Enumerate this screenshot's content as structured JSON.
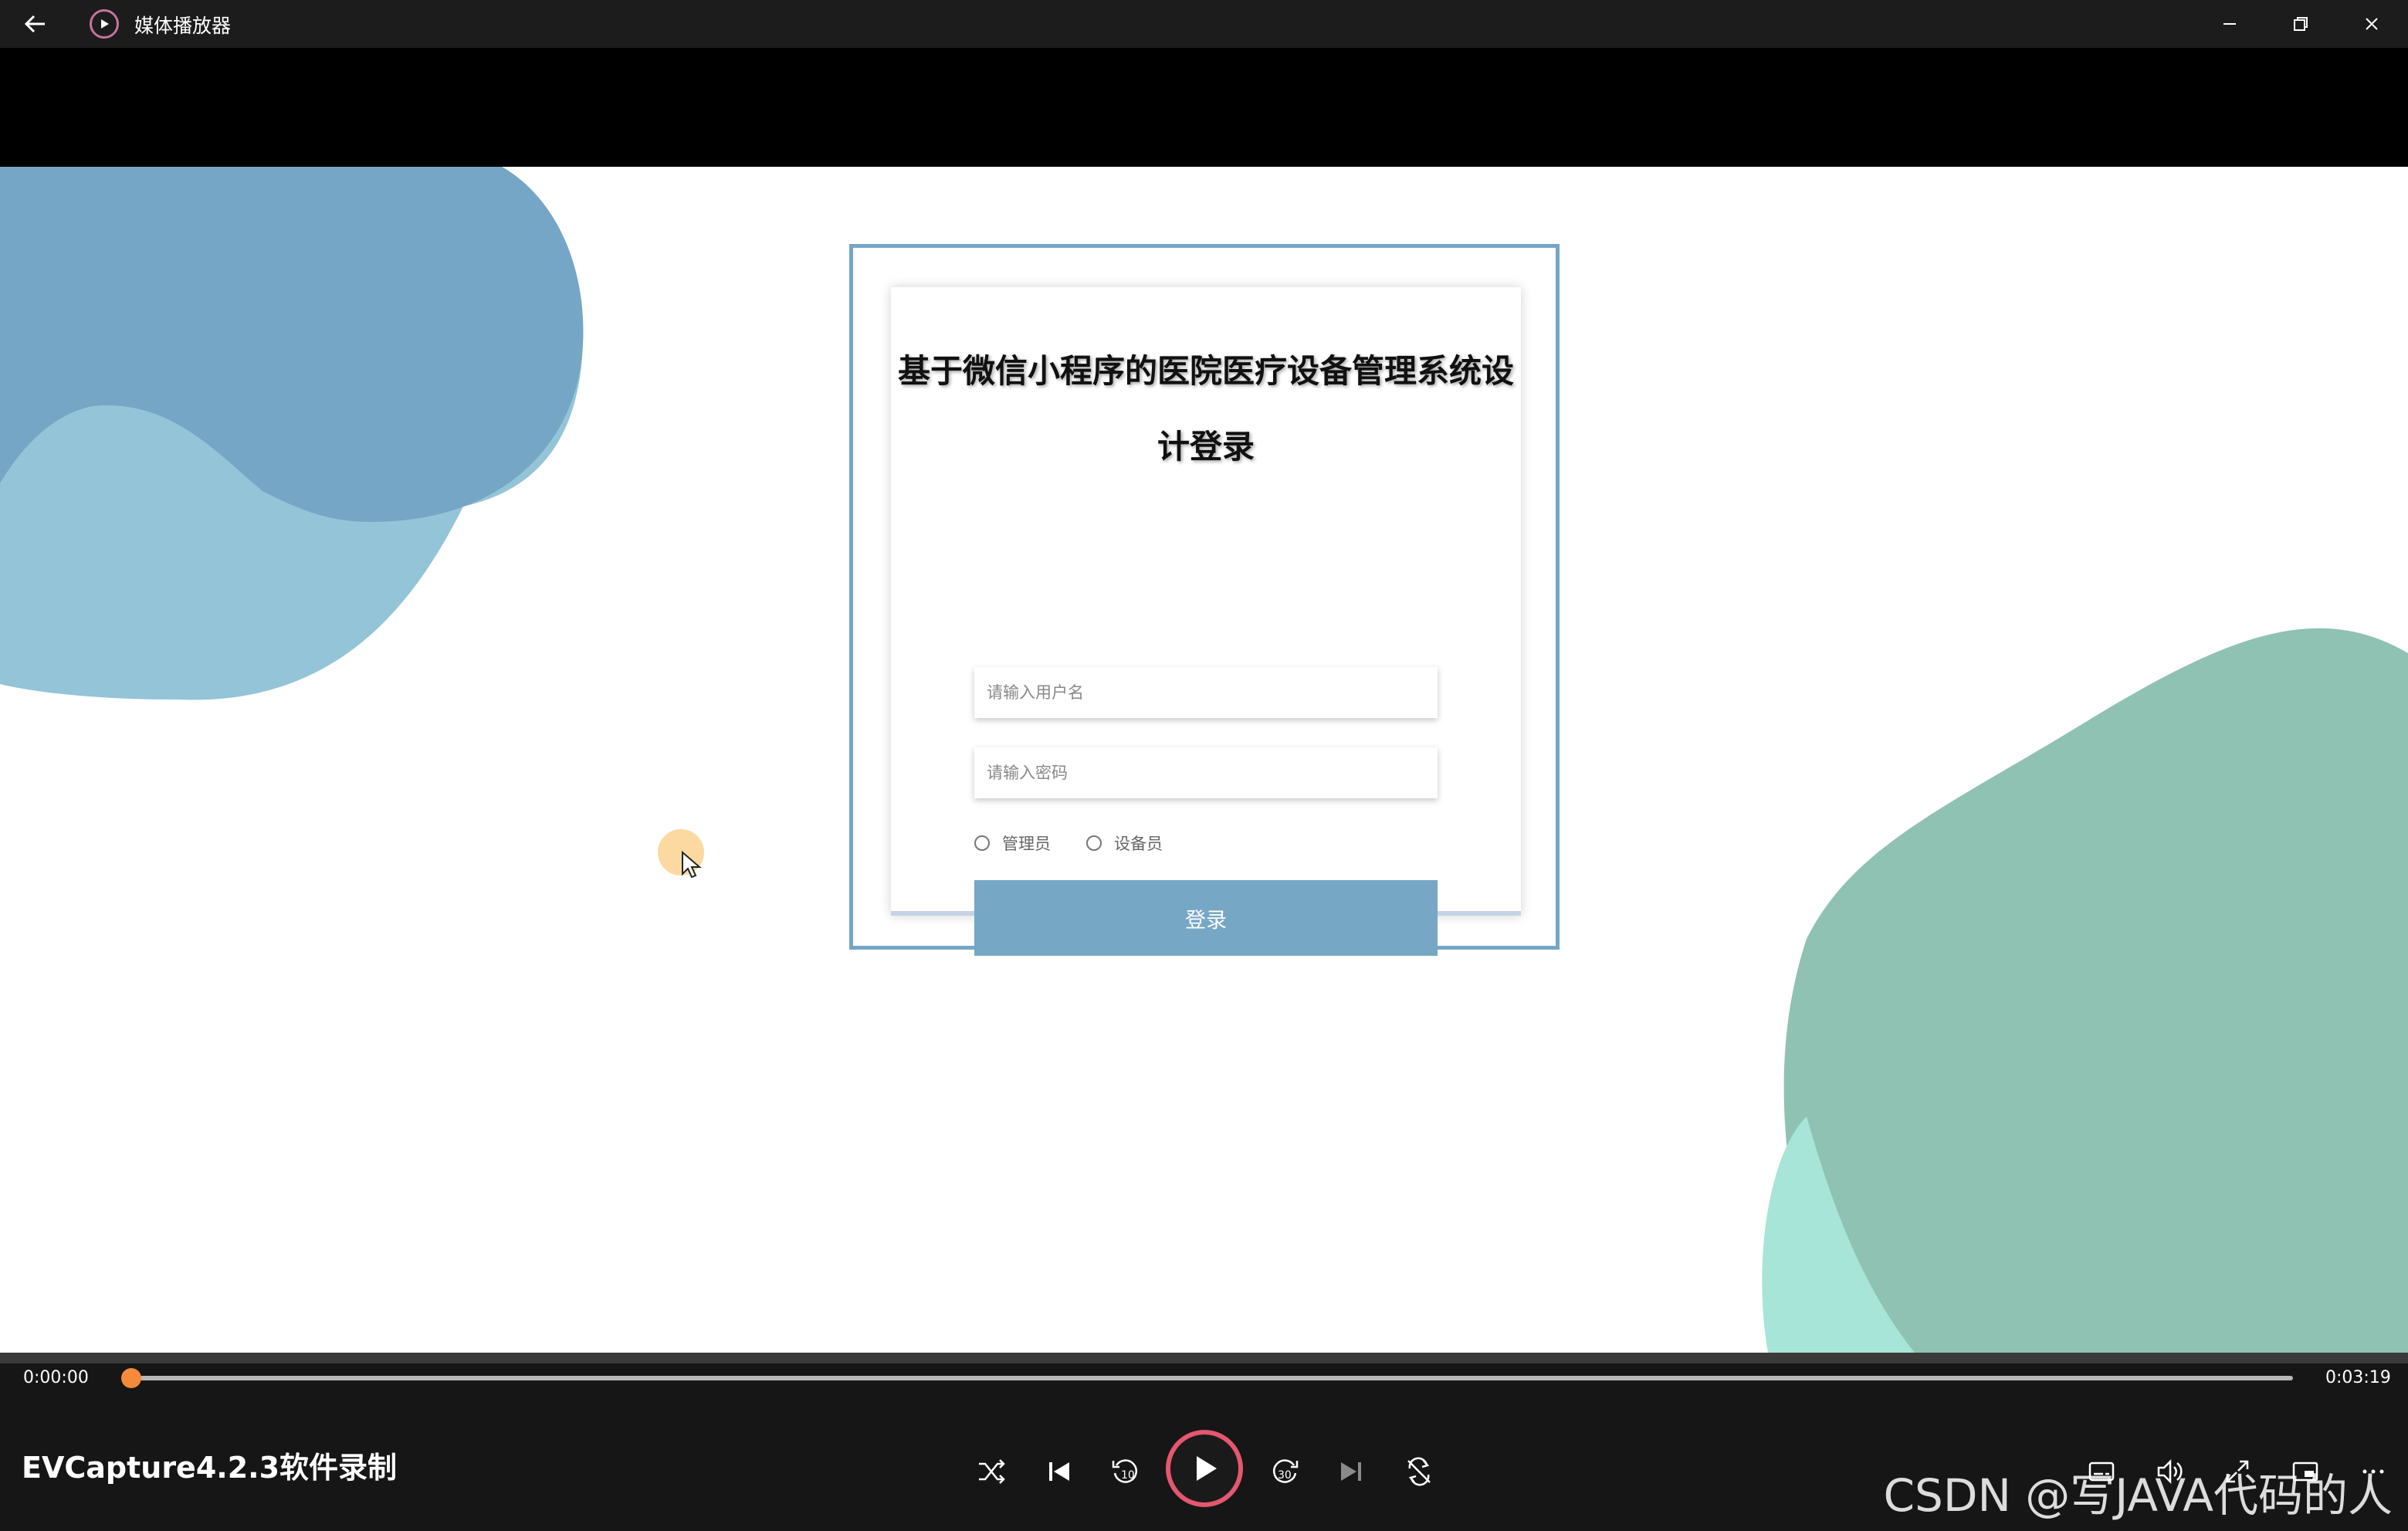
{
  "window": {
    "title": "媒体播放器"
  },
  "login": {
    "title": "基于微信小程序的医院医疗设备管理系统设计登录",
    "username_placeholder": "请输入用户名",
    "password_placeholder": "请输入密码",
    "roles": [
      "管理员",
      "设备员"
    ],
    "button_label": "登录",
    "accent_color": "#76a7c5"
  },
  "player": {
    "current_time": "0:00:00",
    "total_time": "0:03:19",
    "progress_fraction": 0,
    "brand_text": "EVCapture4.2.3软件录制",
    "watermark": "CSDN @写JAVA代码的人",
    "accent_color": "#f58a3a"
  },
  "icons": [
    "back-arrow-icon",
    "media-player-icon",
    "minimize-icon",
    "restore-icon",
    "close-icon",
    "shuffle-icon",
    "skip-previous-icon",
    "rewind-10-icon",
    "play-icon",
    "forward-30-icon",
    "skip-next-icon",
    "repeat-off-icon",
    "subtitles-icon",
    "volume-icon",
    "fullscreen-icon",
    "mini-player-icon",
    "more-icon"
  ]
}
